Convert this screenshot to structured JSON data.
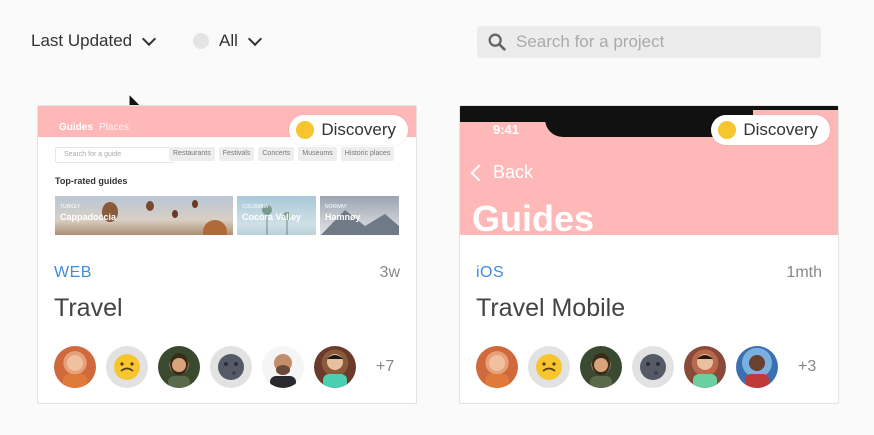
{
  "toolbar": {
    "sort_label": "Last Updated",
    "filter_label": "All",
    "search_placeholder": "Search for a project"
  },
  "projects": [
    {
      "platform": "WEB",
      "age": "3w",
      "title": "Travel",
      "status": "Discovery",
      "more_members": "+7",
      "preview": {
        "nav": [
          "Guides",
          "Places"
        ],
        "search_placeholder": "Search for a guide",
        "chips": [
          "Restaurants",
          "Festivals",
          "Concerts",
          "Museums",
          "Historic places"
        ],
        "section": "Top-rated guides",
        "tiles": [
          {
            "country": "TURKEY",
            "name": "Cappadoccia"
          },
          {
            "country": "COLOMBIA",
            "name": "Cocora Valley"
          },
          {
            "country": "NORWAY",
            "name": "Hamnøy"
          }
        ]
      }
    },
    {
      "platform": "iOS",
      "age": "1mth",
      "title": "Travel Mobile",
      "status": "Discovery",
      "more_members": "+3",
      "preview": {
        "time": "9:41",
        "back": "Back",
        "heading": "Guides"
      }
    }
  ],
  "colors": {
    "accent_pink": "#ffb8b8",
    "status_yellow": "#f7c62f",
    "platform_blue": "#3a8edb"
  }
}
